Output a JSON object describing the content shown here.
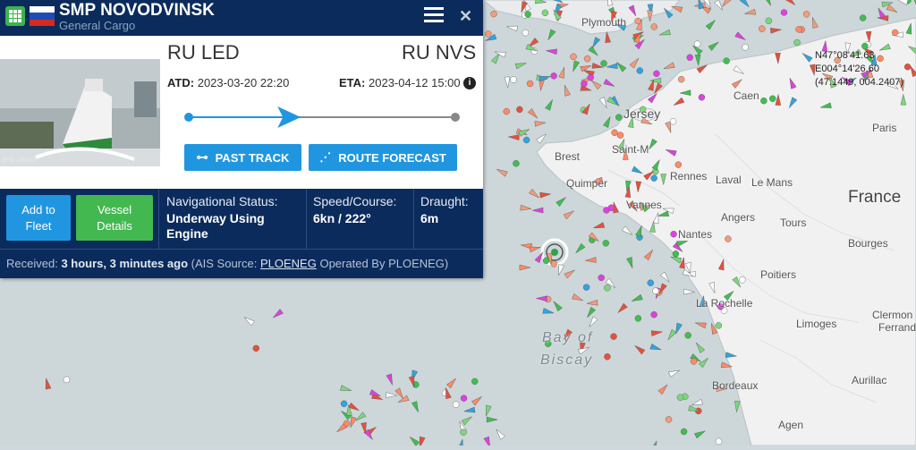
{
  "vessel": {
    "name": "SMP NOVODVINSK",
    "type": "General Cargo",
    "flag_colors": [
      "#ffffff",
      "#1f4bb5",
      "#d52b1e"
    ],
    "photo_caption": "ship photo"
  },
  "voyage": {
    "from_port": "RU LED",
    "to_port": "RU NVS",
    "atd_label": "ATD:",
    "atd_value": "2023-03-20 22:20",
    "eta_label": "ETA:",
    "eta_value": "2023-04-12 15:00",
    "progress": 0.38
  },
  "buttons": {
    "past_track": "PAST TRACK",
    "route_forecast": "ROUTE FORECAST",
    "add_to_fleet_1": "Add to",
    "add_to_fleet_2": "Fleet",
    "vessel_details_1": "Vessel",
    "vessel_details_2": "Details"
  },
  "info": {
    "nav_status_label": "Navigational Status:",
    "nav_status_value_1": "Underway Using",
    "nav_status_value_2": "Engine",
    "speed_label": "Speed/Course:",
    "speed_value": "6kn / 222°",
    "draught_label": "Draught:",
    "draught_value": "6m"
  },
  "received": {
    "prefix": "Received:",
    "time": "3 hours, 3 minutes ago",
    "source_prefix": "(AIS Source:",
    "source_link": "PLOENEG",
    "source_suffix": "Operated By PLOENEG)"
  },
  "map": {
    "coordinates": [
      "N47°08'41.63",
      "E004°14'26.60",
      "(47.1449, 004.2407)"
    ],
    "labels": {
      "plymouth": "Plymouth",
      "jersey": "Jersey",
      "saint_malo": "Saint-M",
      "brest": "Brest",
      "quimper": "Quimper",
      "rennes": "Rennes",
      "laval": "Laval",
      "le_mans": "Le Mans",
      "vannes": "Vannes",
      "angers": "Angers",
      "tours": "Tours",
      "nantes": "Nantes",
      "france": "France",
      "bourges": "Bourges",
      "poitiers": "Poitiers",
      "la_rochelle": "La Rochelle",
      "limoges": "Limoges",
      "clermont": "Clermon",
      "ferrand": "Ferrand",
      "bay_of": "Bay of",
      "biscay": "Biscay",
      "bordeaux": "Bordeaux",
      "aurillac": "Aurillac",
      "agen": "Agen",
      "paris": "Paris",
      "caen": "Caen"
    }
  }
}
